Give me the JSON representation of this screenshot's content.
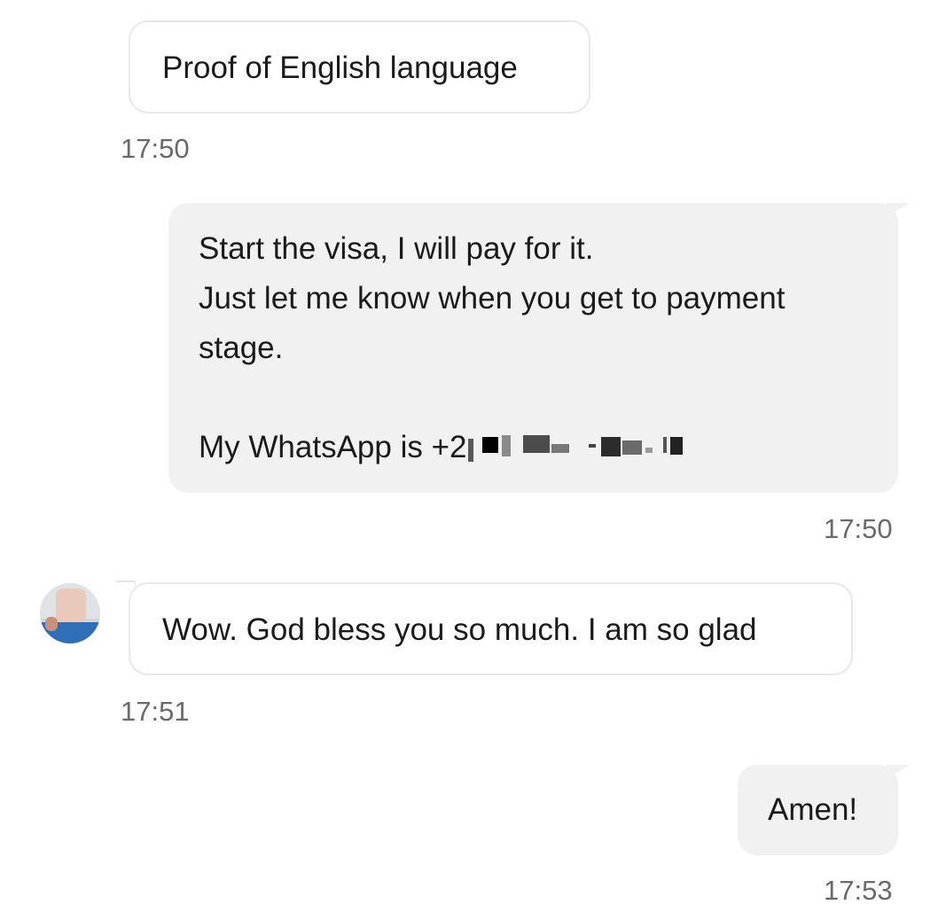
{
  "messages": [
    {
      "direction": "incoming",
      "text": "Proof of English language",
      "time": "17:50"
    },
    {
      "direction": "outgoing",
      "lines": [
        "Start the visa, I will pay for it.",
        "Just let me know when you get to payment",
        "stage.",
        "",
        "My WhatsApp is +2"
      ],
      "time": "17:50"
    },
    {
      "direction": "incoming",
      "text": "Wow. God bless you so much. I am so glad",
      "time": "17:51"
    },
    {
      "direction": "outgoing",
      "text": "Amen!",
      "time": "17:53"
    }
  ],
  "avatar_icon": "contact-avatar-blurred",
  "colors": {
    "incoming_bubble": "#ffffff",
    "incoming_border": "#e8e8e8",
    "outgoing_bubble": "#f1f1f1",
    "timestamp": "#6a6a6a",
    "text": "#1b1b1b"
  }
}
